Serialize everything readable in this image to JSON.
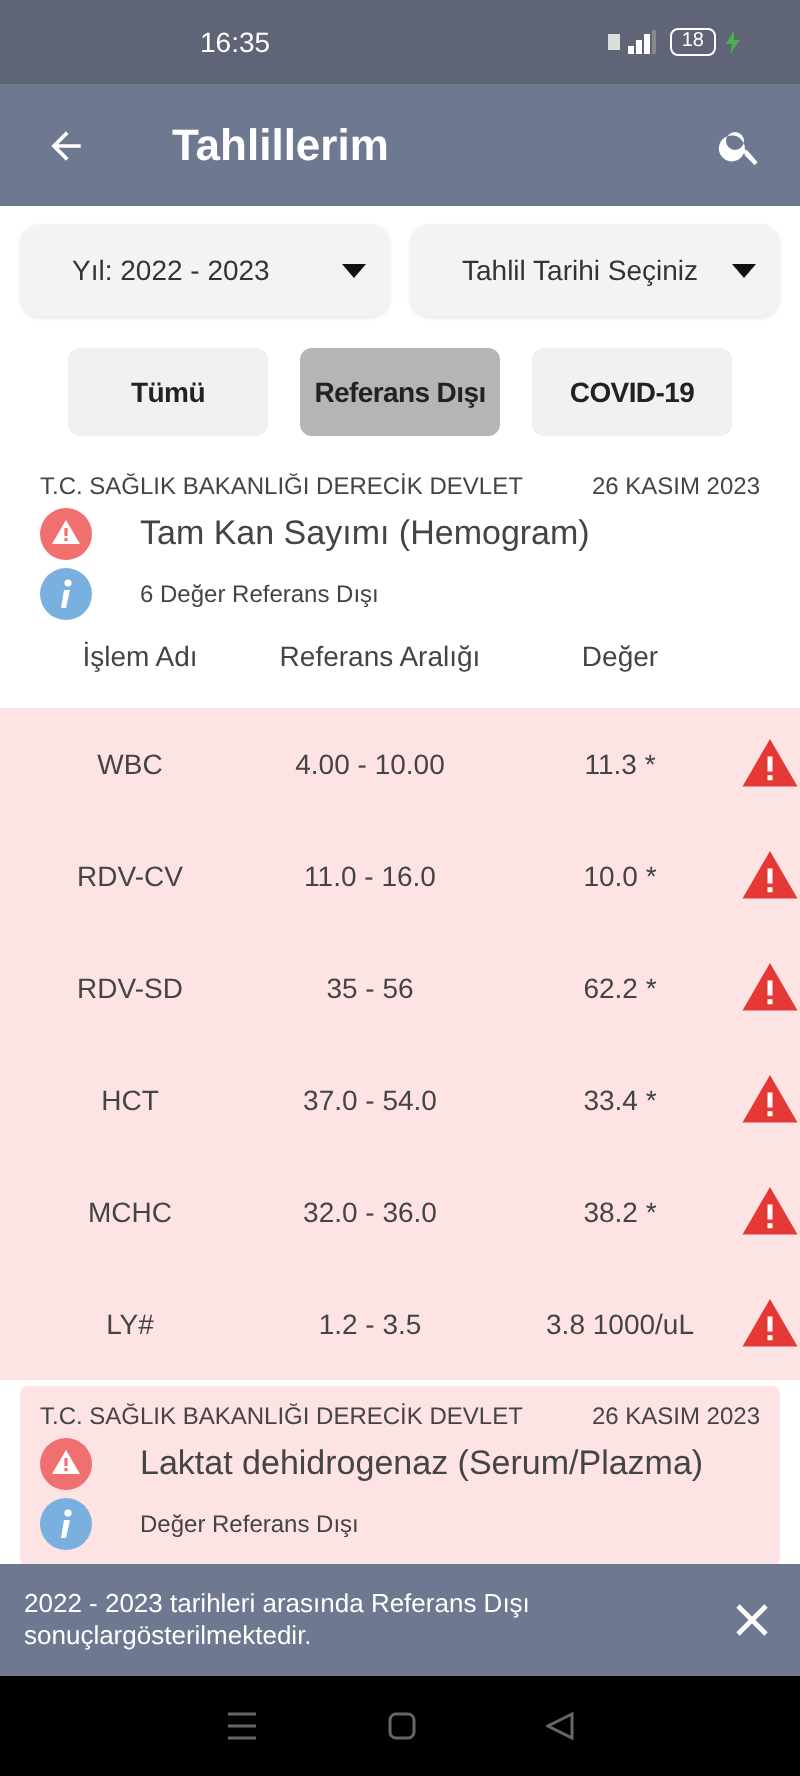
{
  "status_bar": {
    "time": "16:35",
    "battery": "18"
  },
  "app_bar": {
    "title": "Tahlillerim"
  },
  "filters": [
    {
      "label": "Yıl: 2022 - 2023"
    },
    {
      "label": "Tahlil Tarihi Seçiniz"
    }
  ],
  "chips": [
    {
      "label": "Tümü",
      "selected": false
    },
    {
      "label": "Referans Dışı",
      "selected": true
    },
    {
      "label": "COVID-19",
      "selected": false
    }
  ],
  "results": [
    {
      "hospital": "T.C. SAĞLIK BAKANLIĞI DERECİK DEVLET",
      "date": "26 KASIM 2023",
      "test": "Tam Kan Sayımı (Hemogram)",
      "summary": "6 Değer Referans Dışı",
      "highlighted": false,
      "columns": [
        "İşlem Adı",
        "Referans Aralığı",
        "Değer"
      ],
      "rows": [
        {
          "name": "WBC",
          "range": "4.00 - 10.00",
          "value": "11.3 *",
          "flagged": true
        },
        {
          "name": "RDV-CV",
          "range": "11.0 - 16.0",
          "value": "10.0 *",
          "flagged": true
        },
        {
          "name": "RDV-SD",
          "range": "35 - 56",
          "value": "62.2 *",
          "flagged": true
        },
        {
          "name": "HCT",
          "range": "37.0 - 54.0",
          "value": "33.4 *",
          "flagged": true
        },
        {
          "name": "MCHC",
          "range": "32.0 - 36.0",
          "value": "38.2 *",
          "flagged": true
        },
        {
          "name": "LY#",
          "range": "1.2 - 3.5",
          "value": "3.8 1000/uL",
          "flagged": true
        }
      ]
    },
    {
      "hospital": "T.C. SAĞLIK BAKANLIĞI DERECİK DEVLET",
      "date": "26 KASIM 2023",
      "test": "Laktat dehidrogenaz (Serum/Plazma)",
      "summary": "Değer Referans Dışı",
      "highlighted": true
    }
  ],
  "snackbar": {
    "message": "2022 - 2023 tarihleri arasında Referans Dışı sonuçlargösterilmektedir."
  }
}
